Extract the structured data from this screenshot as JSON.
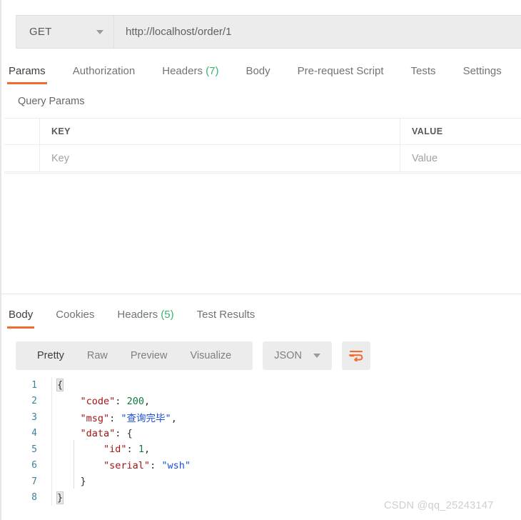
{
  "request": {
    "method": "GET",
    "url": "http://localhost/order/1",
    "method_caret_icon": "chevron-down-icon",
    "tabs": [
      {
        "label": "Params",
        "count": "",
        "active": true
      },
      {
        "label": "Authorization",
        "count": "",
        "active": false
      },
      {
        "label": "Headers",
        "count": "(7)",
        "active": false
      },
      {
        "label": "Body",
        "count": "",
        "active": false
      },
      {
        "label": "Pre-request Script",
        "count": "",
        "active": false
      },
      {
        "label": "Tests",
        "count": "",
        "active": false
      },
      {
        "label": "Settings",
        "count": "",
        "active": false
      }
    ]
  },
  "query_params": {
    "title": "Query Params",
    "headers": {
      "key": "KEY",
      "value": "VALUE"
    },
    "placeholder_row": {
      "key": "Key",
      "value": "Value"
    }
  },
  "response": {
    "tabs": [
      {
        "label": "Body",
        "count": "",
        "active": true
      },
      {
        "label": "Cookies",
        "count": "",
        "active": false
      },
      {
        "label": "Headers",
        "count": "(5)",
        "active": false
      },
      {
        "label": "Test Results",
        "count": "",
        "active": false
      }
    ],
    "format_modes": [
      {
        "label": "Pretty",
        "active": true
      },
      {
        "label": "Raw",
        "active": false
      },
      {
        "label": "Preview",
        "active": false
      },
      {
        "label": "Visualize",
        "active": false
      }
    ],
    "language": "JSON",
    "language_caret_icon": "chevron-down-icon",
    "wrap_button_icon": "wrap-text-icon",
    "body_lines": [
      {
        "no": "1",
        "segments": [
          {
            "t": "{",
            "c": "pun brace"
          }
        ]
      },
      {
        "no": "2",
        "segments": [
          {
            "t": "    ",
            "c": "pun"
          },
          {
            "t": "\"code\"",
            "c": "key"
          },
          {
            "t": ": ",
            "c": "pun"
          },
          {
            "t": "200",
            "c": "num"
          },
          {
            "t": ",",
            "c": "pun"
          }
        ]
      },
      {
        "no": "3",
        "segments": [
          {
            "t": "    ",
            "c": "pun"
          },
          {
            "t": "\"msg\"",
            "c": "key"
          },
          {
            "t": ": ",
            "c": "pun"
          },
          {
            "t": "\"查询完毕\"",
            "c": "str"
          },
          {
            "t": ",",
            "c": "pun"
          }
        ]
      },
      {
        "no": "4",
        "segments": [
          {
            "t": "    ",
            "c": "pun"
          },
          {
            "t": "\"data\"",
            "c": "key"
          },
          {
            "t": ": ",
            "c": "pun"
          },
          {
            "t": "{",
            "c": "pun"
          }
        ]
      },
      {
        "no": "5",
        "segments": [
          {
            "t": "        ",
            "c": "pun"
          },
          {
            "t": "\"id\"",
            "c": "key"
          },
          {
            "t": ": ",
            "c": "pun"
          },
          {
            "t": "1",
            "c": "num"
          },
          {
            "t": ",",
            "c": "pun"
          }
        ]
      },
      {
        "no": "6",
        "segments": [
          {
            "t": "        ",
            "c": "pun"
          },
          {
            "t": "\"serial\"",
            "c": "key"
          },
          {
            "t": ": ",
            "c": "pun"
          },
          {
            "t": "\"wsh\"",
            "c": "str"
          }
        ]
      },
      {
        "no": "7",
        "segments": [
          {
            "t": "    ",
            "c": "pun"
          },
          {
            "t": "}",
            "c": "pun"
          }
        ]
      },
      {
        "no": "8",
        "segments": [
          {
            "t": "}",
            "c": "pun brace"
          }
        ]
      }
    ]
  },
  "watermark": "CSDN @qq_25243147",
  "colors": {
    "accent": "#ef6c33",
    "count_green": "#3bb273",
    "json_key": "#a31515",
    "json_string": "#1a4fd6",
    "json_number": "#0f7b3f",
    "lineno": "#3e7f9c"
  }
}
